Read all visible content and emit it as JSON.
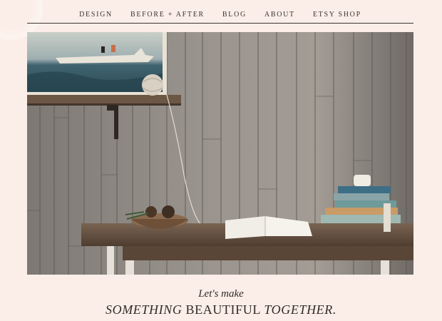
{
  "nav": {
    "items": [
      {
        "label": "DESIGN"
      },
      {
        "label": "BEFORE + AFTER"
      },
      {
        "label": "BLOG"
      },
      {
        "label": "ABOUT"
      },
      {
        "label": "ETSY SHOP"
      }
    ]
  },
  "tagline": {
    "small": "Let's make",
    "word1": "SOMETHING",
    "word2": "BEAUTIFUL",
    "word3": "TOGETHER."
  },
  "colors": {
    "page_background": "#fbeee9",
    "text": "#2f2a27",
    "wood_wall": "#8e8882"
  }
}
